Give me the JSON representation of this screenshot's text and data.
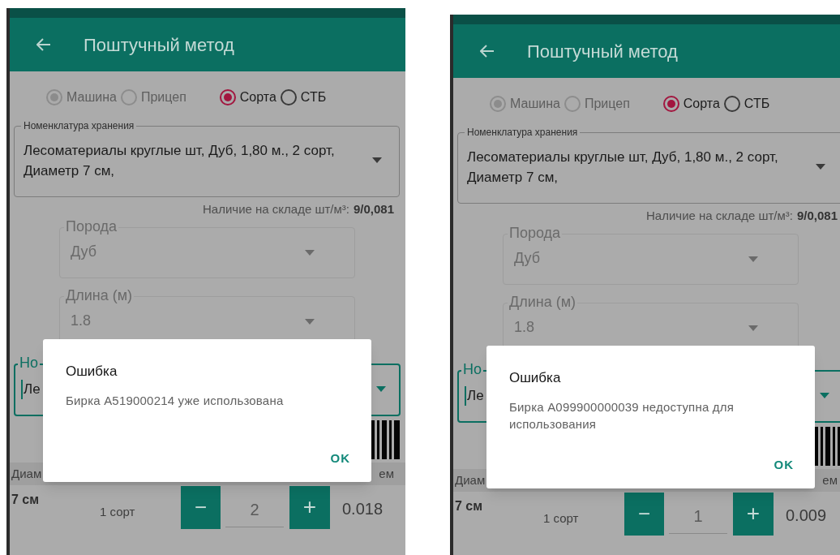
{
  "phones": [
    {
      "app_bar": {
        "title": "Поштучный метод"
      },
      "radio_groups": [
        {
          "disabled": true,
          "options": [
            {
              "label": "Машина",
              "selected": true
            },
            {
              "label": "Прицеп",
              "selected": false
            }
          ]
        },
        {
          "disabled": false,
          "options": [
            {
              "label": "Сорта",
              "selected": true
            },
            {
              "label": "СТБ",
              "selected": false
            }
          ]
        }
      ],
      "storage_field": {
        "label": "Номенклатура хранения",
        "value": "Лесоматериалы круглые шт, Дуб, 1,80 м., 2 сорт, Диаметр 7 см,"
      },
      "stock": {
        "label": "Наличие на складе шт/м³:",
        "value": "9/0,081"
      },
      "select_fields": [
        {
          "label": "Порода",
          "value": "Дуб",
          "disabled": true
        },
        {
          "label": "Длина (м)",
          "value": "1.8",
          "disabled": true
        }
      ],
      "scan_field": {
        "label": "Но",
        "value": "Ле"
      },
      "table": {
        "columns": [
          "Диам",
          "ем"
        ],
        "rows": [
          {
            "diameter": "7 см",
            "grade": "1 сорт",
            "minus": "−",
            "quantity": "2",
            "plus": "+",
            "volume": "0.018"
          }
        ]
      },
      "dialog": {
        "title": "Ошибка",
        "message": "Бирка A519000214 уже использована",
        "button": "OK"
      }
    },
    {
      "app_bar": {
        "title": "Поштучный метод"
      },
      "radio_groups": [
        {
          "disabled": true,
          "options": [
            {
              "label": "Машина",
              "selected": true
            },
            {
              "label": "Прицеп",
              "selected": false
            }
          ]
        },
        {
          "disabled": false,
          "options": [
            {
              "label": "Сорта",
              "selected": true
            },
            {
              "label": "СТБ",
              "selected": false
            }
          ]
        }
      ],
      "storage_field": {
        "label": "Номенклатура хранения",
        "value": "Лесоматериалы круглые шт, Дуб, 1,80 м., 2 сорт, Диаметр 7 см,"
      },
      "stock": {
        "label": "Наличие на складе шт/м³:",
        "value": "9/0,081"
      },
      "select_fields": [
        {
          "label": "Порода",
          "value": "Дуб",
          "disabled": true
        },
        {
          "label": "Длина (м)",
          "value": "1.8",
          "disabled": true
        }
      ],
      "scan_field": {
        "label": "Но",
        "value": "Ле"
      },
      "table": {
        "columns": [
          "Диам",
          "ем"
        ],
        "rows": [
          {
            "diameter": "7 см",
            "grade": "1 сорт",
            "minus": "−",
            "quantity": "1",
            "plus": "+",
            "volume": "0.009"
          }
        ]
      },
      "dialog": {
        "title": "Ошибка",
        "message": "Бирка A099900000039 недоступна для использования",
        "button": "OK"
      }
    }
  ]
}
